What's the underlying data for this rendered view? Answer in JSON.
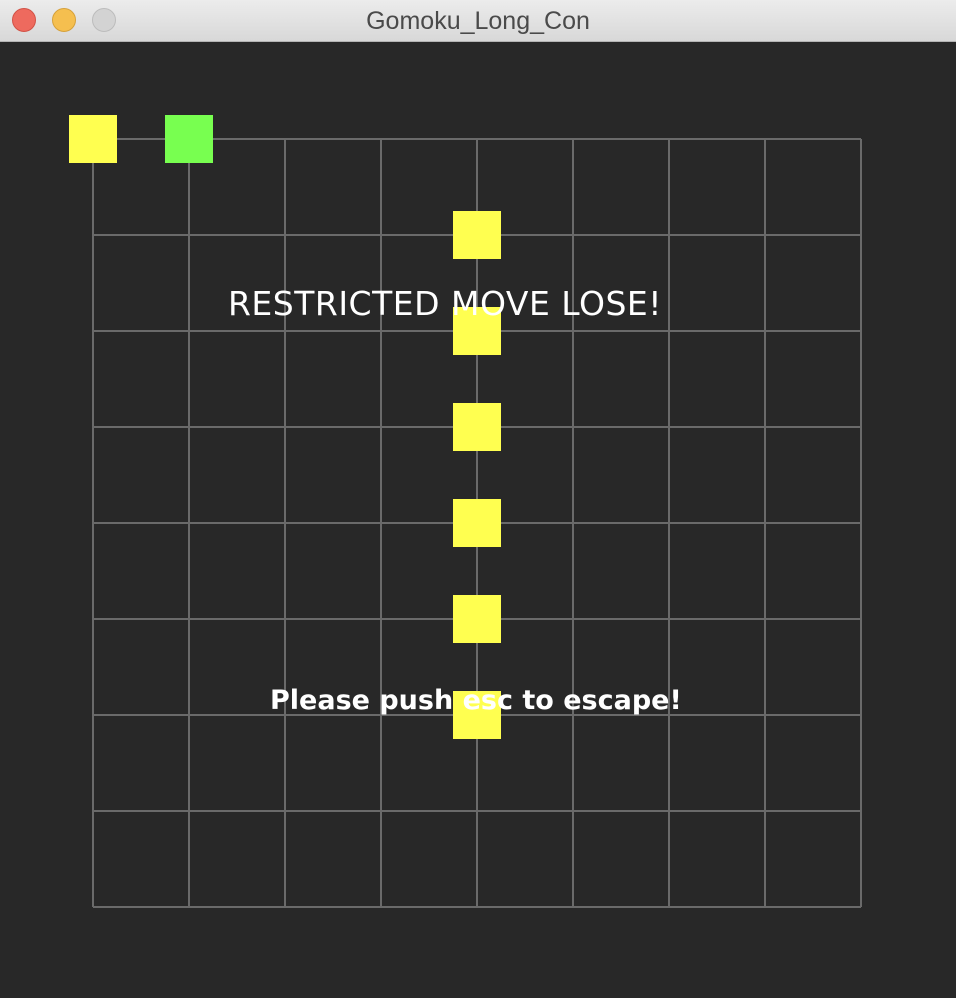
{
  "window": {
    "title": "Gomoku_Long_Con",
    "controls": [
      "close",
      "minimize",
      "zoom"
    ]
  },
  "board": {
    "background_color": "#282828",
    "grid_color": "#6a6a6a",
    "columns": 9,
    "rows": 9
  },
  "stones": [
    {
      "col": 0,
      "row": 0,
      "color": "#ffff50"
    },
    {
      "col": 1,
      "row": 0,
      "color": "#78ff50"
    },
    {
      "col": 4,
      "row": 1,
      "color": "#ffff50"
    },
    {
      "col": 4,
      "row": 2,
      "color": "#ffff50"
    },
    {
      "col": 4,
      "row": 3,
      "color": "#ffff50"
    },
    {
      "col": 4,
      "row": 4,
      "color": "#ffff50"
    },
    {
      "col": 4,
      "row": 5,
      "color": "#ffff50"
    },
    {
      "col": 4,
      "row": 6,
      "color": "#ffff50"
    }
  ],
  "messages": {
    "result": "RESTRICTED MOVE LOSE!",
    "hint": "Please push esc to escape!"
  }
}
